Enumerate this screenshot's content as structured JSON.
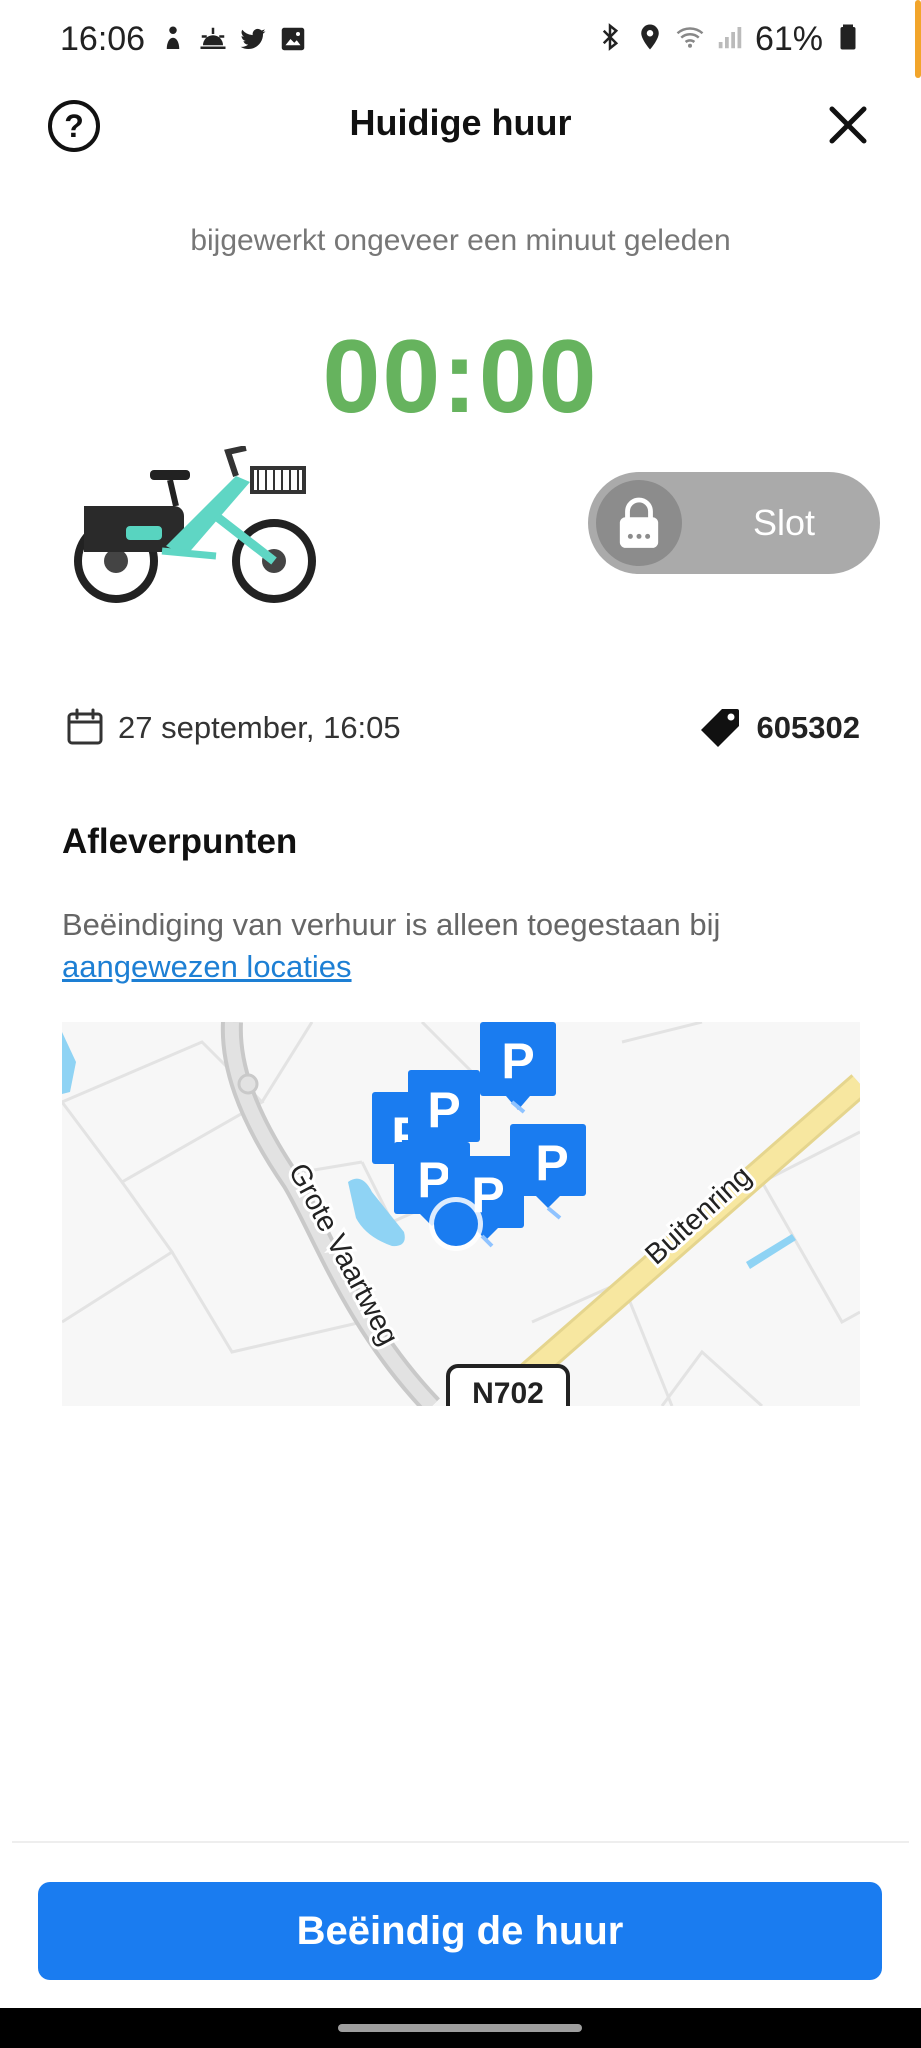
{
  "status_bar": {
    "time": "16:06",
    "battery_text": "61%",
    "left_icons": [
      "notification-person-icon",
      "weather-sunrise-icon",
      "twitter-icon",
      "gallery-icon"
    ],
    "right_icons": [
      "bluetooth-icon",
      "location-icon",
      "wifi-icon",
      "signal-icon",
      "battery-icon"
    ]
  },
  "app_bar": {
    "title": "Huidige huur",
    "help_icon": "question-circle-icon",
    "close_icon": "close-icon"
  },
  "rental": {
    "updated_text": "bijgewerkt ongeveer een minuut geleden",
    "timer": "00:00",
    "lock_label": "Slot",
    "date_text": "27 september, 16:05",
    "vehicle_code": "605302",
    "timer_color": "#66b35e"
  },
  "dropoff": {
    "title": "Afleverpunten",
    "description": "Beëindiging van verhuur is alleen toegestaan bij",
    "link_text": "aangewezen locaties"
  },
  "map": {
    "road_label_1": "Grote Vaartweg",
    "road_label_2": "Buitenring",
    "road_sign": "N702",
    "parking_marker_label": "P",
    "marker_color": "#1a7cf0"
  },
  "footer": {
    "end_button_label": "Beëindig de huur",
    "button_color": "#1a7cf0"
  }
}
